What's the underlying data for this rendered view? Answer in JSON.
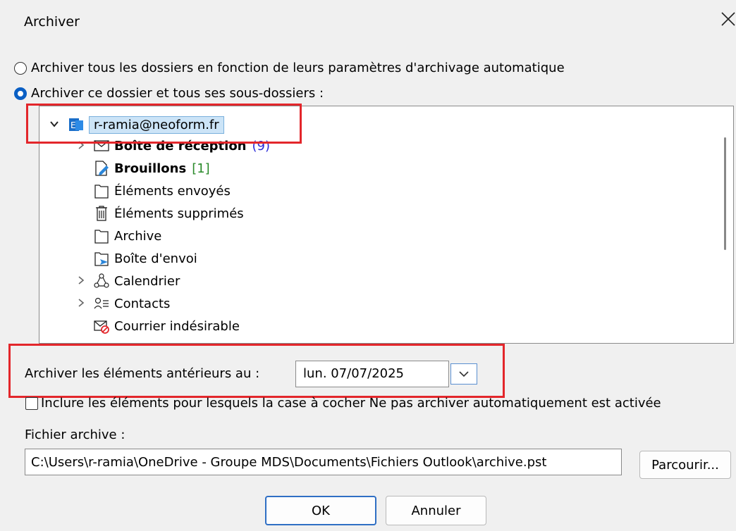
{
  "window": {
    "title": "Archiver"
  },
  "options": {
    "radio_all": "Archiver tous les dossiers en fonction de leurs paramètres d'archivage automatique",
    "radio_folder": "Archiver ce dossier et tous ses sous-dossiers :"
  },
  "tree": {
    "account": "r-ramia@neoform.fr",
    "items": [
      {
        "label": "Boîte de réception",
        "count": "(9)"
      },
      {
        "label": "Brouillons",
        "count": "[1]"
      },
      {
        "label": "Éléments envoyés"
      },
      {
        "label": "Éléments supprimés"
      },
      {
        "label": "Archive"
      },
      {
        "label": "Boîte d'envoi"
      },
      {
        "label": "Calendrier"
      },
      {
        "label": "Contacts"
      },
      {
        "label": "Courrier indésirable"
      }
    ]
  },
  "date": {
    "label": "Archiver les éléments antérieurs au :",
    "value": "lun. 07/07/2025"
  },
  "checkbox": {
    "label": "Inclure les éléments pour lesquels la case à cocher Ne pas archiver automatiquement est activée"
  },
  "file": {
    "label": "Fichier archive :",
    "path": "C:\\Users\\r-ramia\\OneDrive - Groupe MDS\\Documents\\Fichiers Outlook\\archive.pst",
    "browse": "Parcourir..."
  },
  "buttons": {
    "ok": "OK",
    "cancel": "Annuler"
  },
  "colors": {
    "accent": "#0a5fc4",
    "highlight": "#e3262b",
    "selection": "#cce4f7"
  }
}
